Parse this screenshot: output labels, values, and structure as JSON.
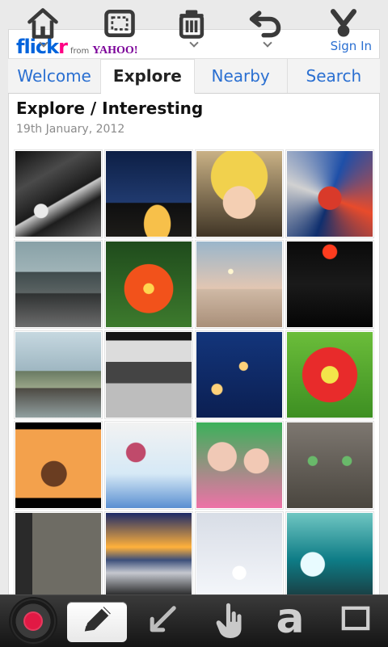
{
  "header": {
    "logo": {
      "brand": "flickr",
      "from": "from",
      "yahoo": "YAHOO!"
    },
    "sign_in": "Sign In"
  },
  "tabs": [
    {
      "label": "Welcome",
      "active": false
    },
    {
      "label": "Explore",
      "active": true
    },
    {
      "label": "Nearby",
      "active": false
    },
    {
      "label": "Search",
      "active": false
    }
  ],
  "main": {
    "title": "Explore / Interesting",
    "date": "19th January, 2012"
  },
  "toolbars": {
    "top": [
      {
        "icon": "home-icon"
      },
      {
        "icon": "select-rectangle-icon"
      },
      {
        "icon": "trash-icon"
      },
      {
        "icon": "undo-icon"
      },
      {
        "icon": "share-icon"
      }
    ],
    "bottom": [
      {
        "icon": "record-icon"
      },
      {
        "icon": "pencil-icon",
        "selected": true
      },
      {
        "icon": "arrow-icon"
      },
      {
        "icon": "hand-pointer-icon"
      },
      {
        "icon": "text-tool-icon",
        "text": "a"
      },
      {
        "icon": "rectangle-icon"
      }
    ]
  },
  "colors": {
    "flickr_blue": "#0063dc",
    "flickr_pink": "#ff0084",
    "link_blue": "#2a6fd1",
    "record_red": "#e11944",
    "toolbar_dark": "#1a1a1a"
  }
}
